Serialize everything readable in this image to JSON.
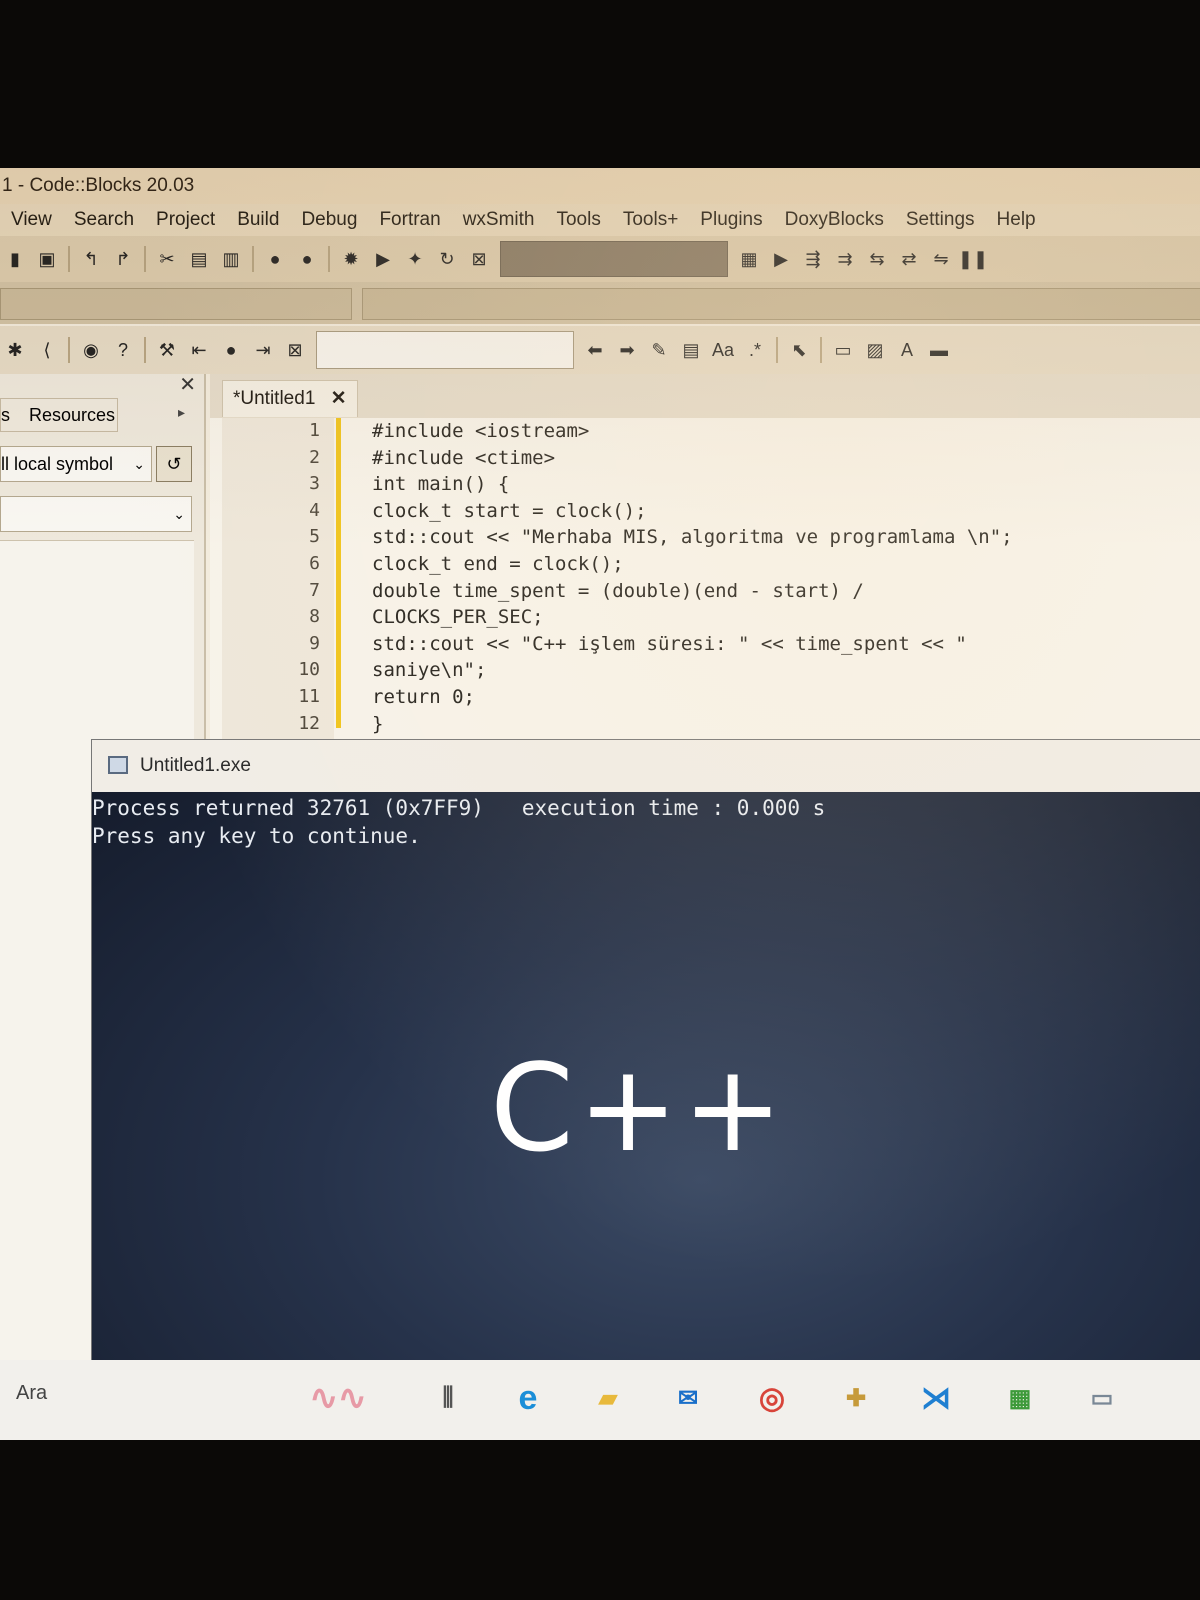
{
  "window": {
    "title": "1 - Code::Blocks 20.03"
  },
  "menu": [
    "View",
    "Search",
    "Project",
    "Build",
    "Debug",
    "Fortran",
    "wxSmith",
    "Tools",
    "Tools+",
    "Plugins",
    "DoxyBlocks",
    "Settings",
    "Help"
  ],
  "left_panel": {
    "tab_partial": "s",
    "tab_resources": "Resources",
    "symbol_combo": "ll local symbol"
  },
  "editor": {
    "tab_label": "*Untitled1",
    "line_numbers": [
      "1",
      "2",
      "3",
      "4",
      "5",
      "6",
      "7",
      "8",
      "9",
      "10",
      "11",
      "12"
    ],
    "lines": [
      "#include <iostream>",
      "#include <ctime>",
      "int main() {",
      "clock_t start = clock();",
      "std::cout << \"Merhaba MIS, algoritma ve programlama \\n\";",
      "clock_t end = clock();",
      "double time_spent = (double)(end - start) /",
      "CLOCKS_PER_SEC;",
      "std::cout << \"C++ işlem süresi: \" << time_spent << \"",
      "saniye\\n\";",
      "return 0;",
      "}"
    ]
  },
  "console": {
    "title": "Untitled1.exe",
    "line1": "Process returned 32761 (0x7FF9)   execution time : 0.000 s",
    "line2": "Press any key to continue.",
    "wallpaper_text": "C++"
  },
  "taskbar": {
    "search_label": "Ara"
  },
  "colors": {
    "accent_marker": "#f0c41b",
    "console_bg": "#1a2236"
  }
}
